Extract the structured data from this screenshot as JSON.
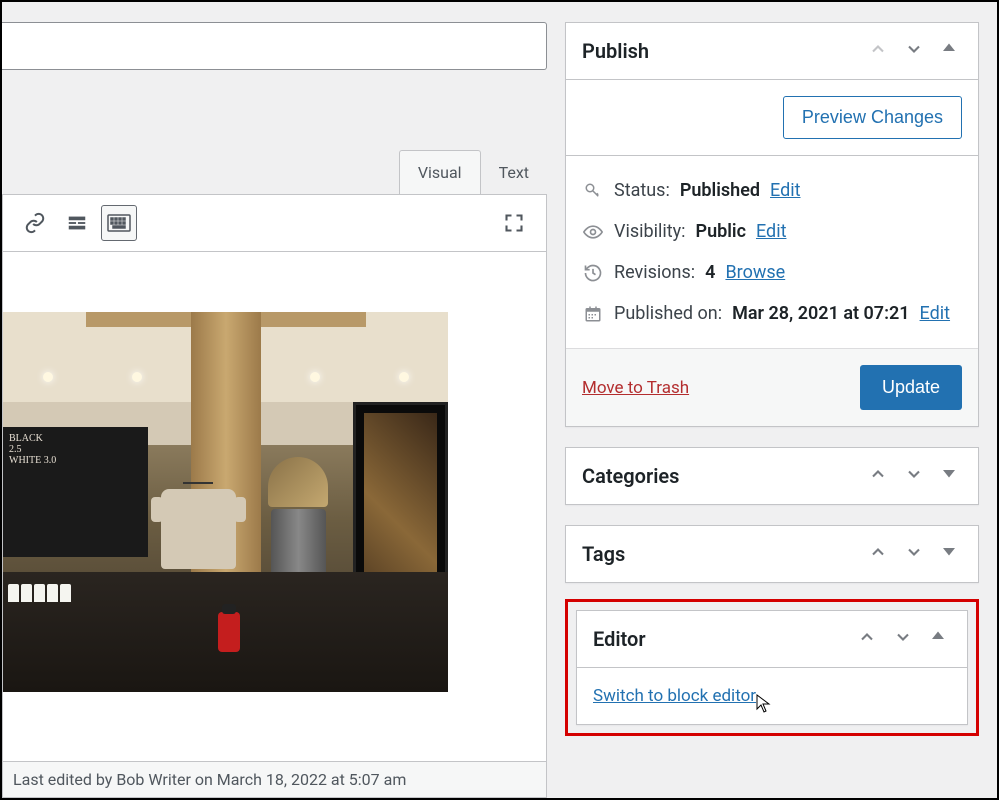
{
  "editor": {
    "tabs": {
      "visual": "Visual",
      "text": "Text",
      "active": "visual"
    },
    "footer": "Last edited by Bob Writer on March 18, 2022 at 5:07 am"
  },
  "chalkboard": {
    "line1": "BLACK",
    "line2": "2.5",
    "line3": "WHITE 3.0"
  },
  "sidebar": {
    "publish": {
      "title": "Publish",
      "preview_label": "Preview Changes",
      "status": {
        "label": "Status:",
        "value": "Published",
        "edit": "Edit"
      },
      "visibility": {
        "label": "Visibility:",
        "value": "Public",
        "edit": "Edit"
      },
      "revisions": {
        "label": "Revisions:",
        "value": "4",
        "browse": "Browse"
      },
      "published": {
        "label": "Published on:",
        "value": "Mar 28, 2021 at 07:21",
        "edit": "Edit"
      },
      "trash": "Move to Trash",
      "update": "Update"
    },
    "categories": {
      "title": "Categories"
    },
    "tags": {
      "title": "Tags"
    },
    "editor_panel": {
      "title": "Editor",
      "switch": "Switch to block editor"
    }
  }
}
